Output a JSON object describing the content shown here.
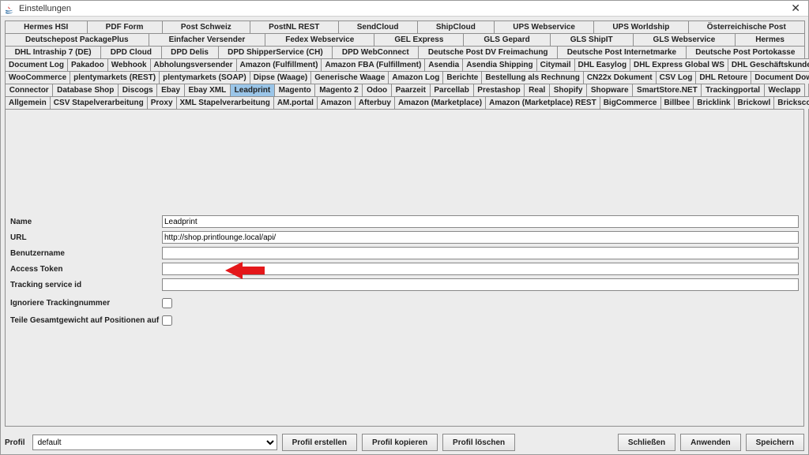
{
  "window": {
    "title": "Einstellungen"
  },
  "tabs": {
    "row0": [
      "Hermes HSI",
      "PDF Form",
      "Post Schweiz",
      "PostNL REST",
      "SendCloud",
      "ShipCloud",
      "UPS Webservice",
      "UPS Worldship",
      "Österreichische Post"
    ],
    "row1": [
      "Deutschepost PackagePlus",
      "Einfacher Versender",
      "Fedex Webservice",
      "GEL Express",
      "GLS Gepard",
      "GLS ShipIT",
      "GLS Webservice",
      "Hermes"
    ],
    "row2": [
      "DHL Intraship 7 (DE)",
      "DPD Cloud",
      "DPD Delis",
      "DPD ShipperService (CH)",
      "DPD WebConnect",
      "Deutsche Post DV Freimachung",
      "Deutsche Post Internetmarke",
      "Deutsche Post Portokasse"
    ],
    "row3": [
      "Document Log",
      "Pakadoo",
      "Webhook",
      "Abholungsversender",
      "Amazon (Fulfillment)",
      "Amazon FBA (Fulfillment)",
      "Asendia",
      "Asendia Shipping",
      "Citymail",
      "DHL Easylog",
      "DHL Express Global WS",
      "DHL Geschäftskundenversand"
    ],
    "row4": [
      "WooCommerce",
      "plentymarkets (REST)",
      "plentymarkets (SOAP)",
      "Dipse (Waage)",
      "Generische Waage",
      "Amazon Log",
      "Berichte",
      "Bestellung als Rechnung",
      "CN22x Dokument",
      "CSV Log",
      "DHL Retoure",
      "Document Downloader"
    ],
    "row5": [
      "Connector",
      "Database Shop",
      "Discogs",
      "Ebay",
      "Ebay XML",
      "Leadprint",
      "Magento",
      "Magento 2",
      "Odoo",
      "Paarzeit",
      "Parcellab",
      "Prestashop",
      "Real",
      "Shopify",
      "Shopware",
      "SmartStore.NET",
      "Trackingportal",
      "Weclapp"
    ],
    "row6": [
      "Allgemein",
      "CSV Stapelverarbeitung",
      "Proxy",
      "XML Stapelverarbeitung",
      "AM.portal",
      "Amazon",
      "Afterbuy",
      "Amazon (Marketplace)",
      "Amazon (Marketplace) REST",
      "BigCommerce",
      "Billbee",
      "Bricklink",
      "Brickowl",
      "Brickscout"
    ]
  },
  "selectedTab": "Leadprint",
  "form": {
    "name_label": "Name",
    "name_value": "Leadprint",
    "url_label": "URL",
    "url_value": "http://shop.printlounge.local/api/",
    "user_label": "Benutzername",
    "user_value": "",
    "token_label": "Access Token",
    "token_value": "",
    "tracking_label": "Tracking service id",
    "tracking_value": "",
    "ignore_label": "Ignoriere Trackingnummer",
    "weight_label": "Teile Gesamtgewicht auf Positionen auf"
  },
  "footer": {
    "profil_label": "Profil",
    "profil_value": "default",
    "create": "Profil erstellen",
    "copy": "Profil kopieren",
    "delete": "Profil löschen",
    "close": "Schließen",
    "apply": "Anwenden",
    "save": "Speichern"
  }
}
